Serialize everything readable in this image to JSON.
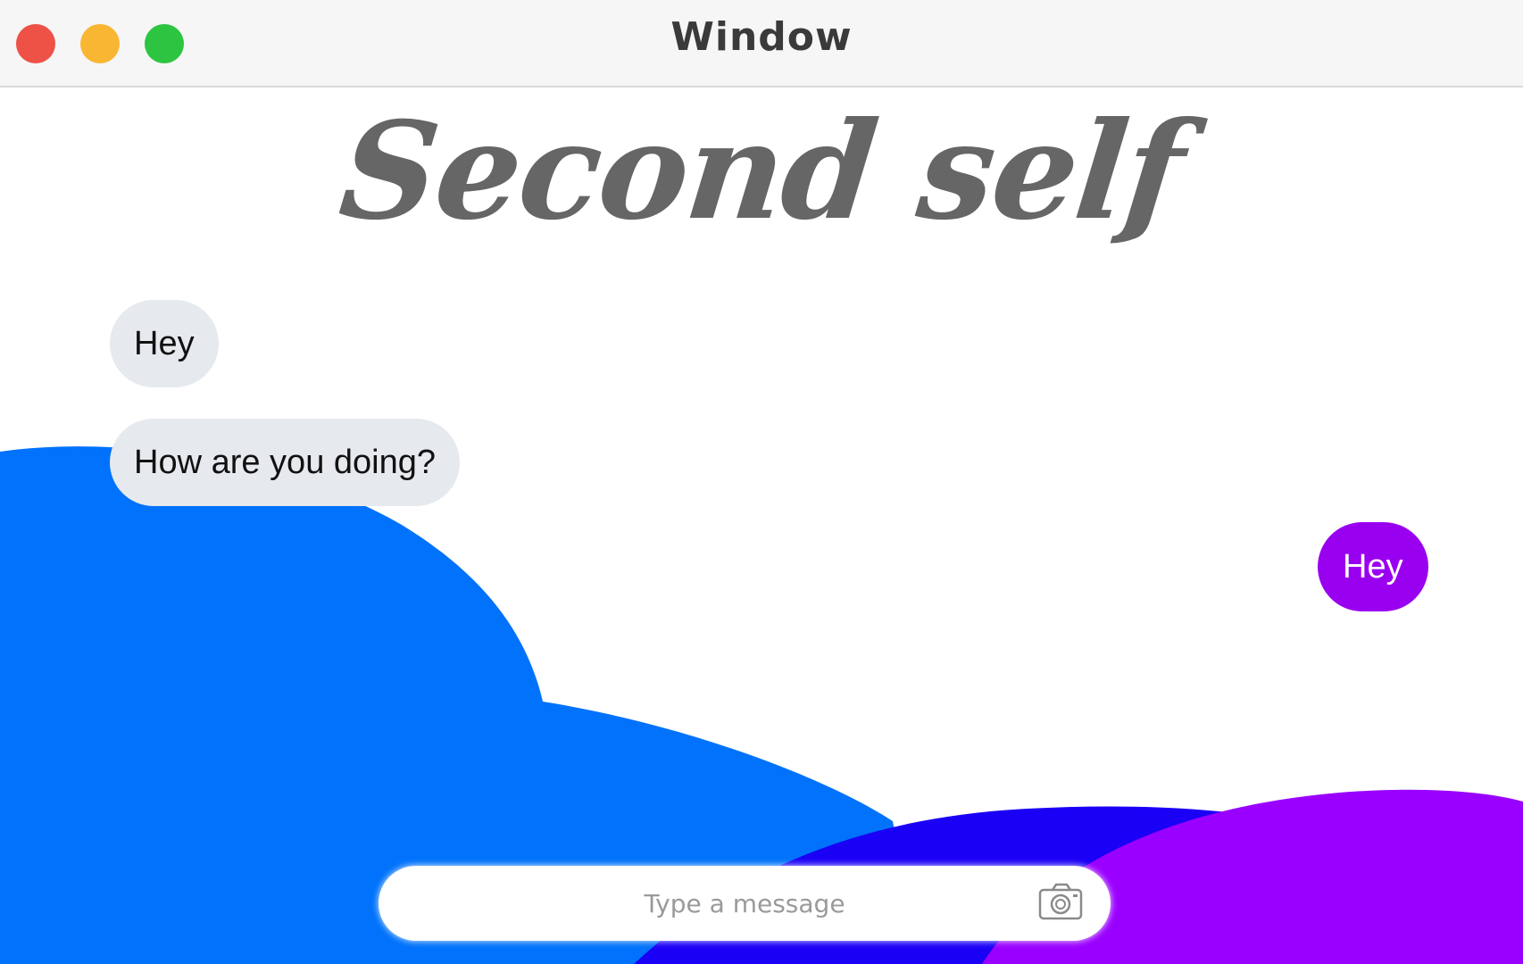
{
  "window": {
    "title": "Window",
    "controls": {
      "close_color": "#ee5146",
      "minimize_color": "#f8b633",
      "zoom_color": "#2cc440"
    }
  },
  "app": {
    "title": "Second self"
  },
  "messages": [
    {
      "direction": "incoming",
      "text": "Hey"
    },
    {
      "direction": "incoming",
      "text": "How are you doing?"
    },
    {
      "direction": "outgoing",
      "text": "Hey"
    }
  ],
  "composer": {
    "value": "",
    "placeholder": "Type a message",
    "attach_icon": "camera-icon"
  },
  "colors": {
    "incoming_bubble": "#e6e9ee",
    "outgoing_bubble": "#9a00f0",
    "wave_blue": "#0072fb",
    "wave_indigo": "#1b00f6",
    "wave_purple": "#9a00ff",
    "title_gray": "#666666"
  }
}
